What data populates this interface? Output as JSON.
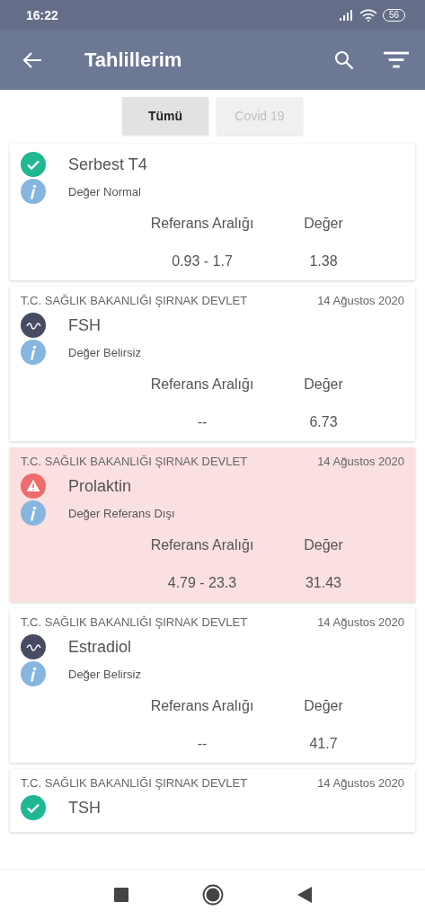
{
  "status_bar": {
    "time": "16:22",
    "battery": "56"
  },
  "app_bar": {
    "title": "Tahlillerim"
  },
  "tabs": [
    {
      "label": "Tümü",
      "selected": true
    },
    {
      "label": "Covid 19",
      "selected": false
    }
  ],
  "results": [
    {
      "kind": "normal",
      "title": "Serbest T4",
      "status_text": "Değer Normal",
      "range_label": "Referans Aralığı",
      "value_label": "Değer",
      "range": "0.93 - 1.7",
      "value": "1.38"
    },
    {
      "kind": "unknown",
      "institution": "T.C. SAĞLIK BAKANLIĞI ŞIRNAK DEVLET",
      "date": "14 Ağustos 2020",
      "title": "FSH",
      "status_text": "Değer Belirsiz",
      "range_label": "Referans Aralığı",
      "value_label": "Değer",
      "range": "--",
      "value": "6.73"
    },
    {
      "kind": "out_of_range",
      "institution": "T.C. SAĞLIK BAKANLIĞI ŞIRNAK DEVLET",
      "date": "14 Ağustos 2020",
      "title": "Prolaktin",
      "status_text": "Değer Referans Dışı",
      "range_label": "Referans Aralığı",
      "value_label": "Değer",
      "range": "4.79 - 23.3",
      "value": "31.43"
    },
    {
      "kind": "unknown",
      "institution": "T.C. SAĞLIK BAKANLIĞI ŞIRNAK DEVLET",
      "date": "14 Ağustos 2020",
      "title": "Estradiol",
      "status_text": "Değer Belirsiz",
      "range_label": "Referans Aralığı",
      "value_label": "Değer",
      "range": "--",
      "value": "41.7"
    },
    {
      "kind": "normal",
      "institution": "T.C. SAĞLIK BAKANLIĞI ŞIRNAK DEVLET",
      "date": "14 Ağustos 2020",
      "title": "TSH"
    }
  ]
}
